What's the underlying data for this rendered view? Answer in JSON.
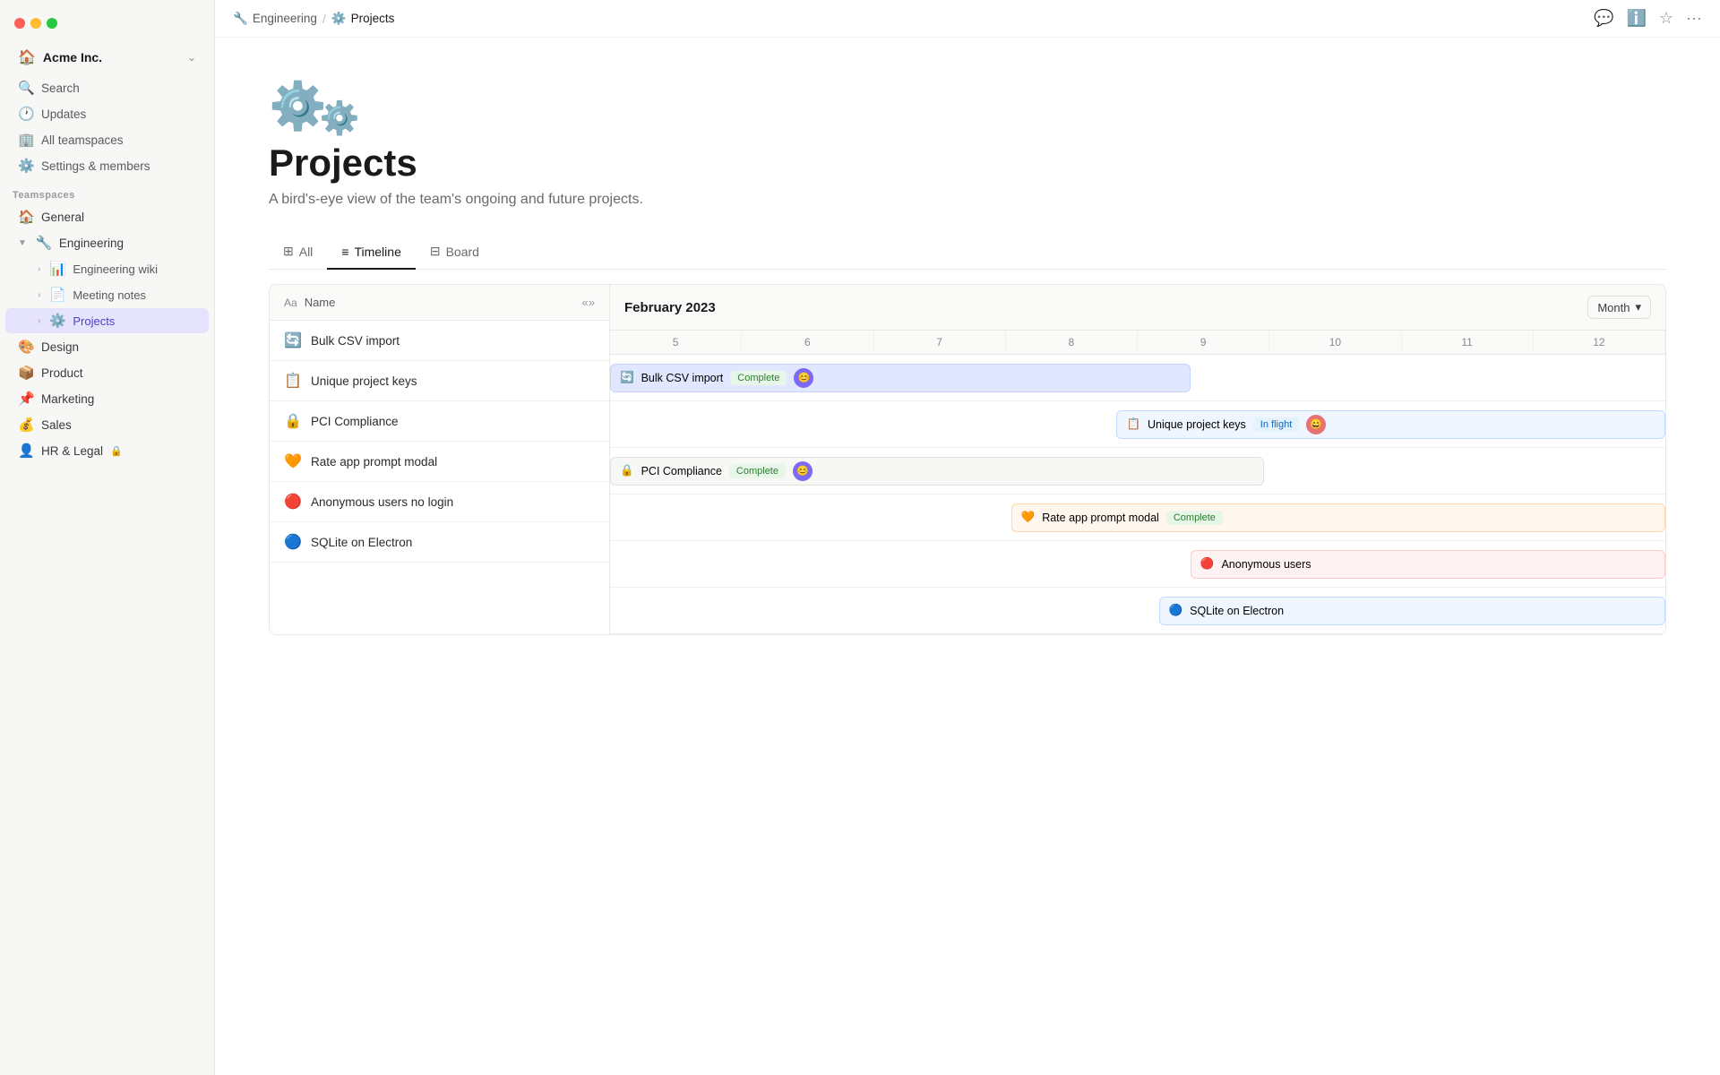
{
  "traffic_lights": [
    "red",
    "yellow",
    "green"
  ],
  "workspace": {
    "name": "Acme Inc.",
    "chevron": "⌃"
  },
  "sidebar_nav": [
    {
      "id": "search",
      "icon": "🔍",
      "label": "Search"
    },
    {
      "id": "updates",
      "icon": "🕐",
      "label": "Updates"
    },
    {
      "id": "all-teamspaces",
      "icon": "🏢",
      "label": "All teamspaces"
    },
    {
      "id": "settings",
      "icon": "⚙️",
      "label": "Settings & members"
    }
  ],
  "teamspaces_label": "Teamspaces",
  "teamspaces": [
    {
      "id": "general",
      "icon": "🏠",
      "label": "General",
      "color": "#e8a020"
    },
    {
      "id": "engineering",
      "icon": "🔧",
      "label": "Engineering",
      "color": "#e05a5a",
      "expanded": true
    },
    {
      "id": "engineering-wiki",
      "icon": "📊",
      "label": "Engineering wiki",
      "indent": true
    },
    {
      "id": "meeting-notes",
      "icon": "📄",
      "label": "Meeting notes",
      "indent": true
    },
    {
      "id": "projects",
      "icon": "⚙️",
      "label": "Projects",
      "indent": true,
      "active": true
    },
    {
      "id": "design",
      "icon": "🎨",
      "label": "Design",
      "color": "#5b9bd5"
    },
    {
      "id": "product",
      "icon": "📦",
      "label": "Product",
      "color": "#e07030"
    },
    {
      "id": "marketing",
      "icon": "📌",
      "label": "Marketing",
      "color": "#c060c0"
    },
    {
      "id": "sales",
      "icon": "💰",
      "label": "Sales",
      "color": "#30a060"
    },
    {
      "id": "hr-legal",
      "icon": "👤",
      "label": "HR & Legal",
      "lock": true
    }
  ],
  "breadcrumb": [
    {
      "id": "engineering",
      "icon": "🔧",
      "label": "Engineering"
    },
    {
      "id": "projects",
      "icon": "⚙️",
      "label": "Projects",
      "current": true
    }
  ],
  "topbar_actions": [
    {
      "id": "comment",
      "icon": "💬"
    },
    {
      "id": "info",
      "icon": "ℹ️"
    },
    {
      "id": "star",
      "icon": "☆"
    },
    {
      "id": "more",
      "icon": "···"
    }
  ],
  "page": {
    "icon": "⚙️",
    "title": "Projects",
    "description": "A bird's-eye view of the team's ongoing and future projects."
  },
  "tabs": [
    {
      "id": "all",
      "icon": "⊞",
      "label": "All"
    },
    {
      "id": "timeline",
      "icon": "≡",
      "label": "Timeline",
      "active": true
    },
    {
      "id": "board",
      "icon": "⊟",
      "label": "Board"
    }
  ],
  "timeline": {
    "collapse_icon": "«»",
    "name_col": "Name",
    "month_label": "February 2023",
    "month_selector": "Month",
    "days": [
      5,
      6,
      7,
      8,
      9,
      10,
      11,
      12
    ],
    "rows": [
      {
        "id": "bulk-csv",
        "icon": "🔄",
        "label": "Bulk CSV import",
        "bar_bg": "#eef2ff",
        "bar_border": "#c7d2fe",
        "bar_label": "Bulk CSV import",
        "status": "Complete",
        "status_class": "status-complete",
        "left_pct": 0,
        "width_pct": 45,
        "has_back_arrow": true,
        "avatar_class": "avatar-1"
      },
      {
        "id": "unique-keys",
        "icon": "📋",
        "label": "Unique project keys",
        "bar_bg": "#eff6ff",
        "bar_border": "#bfdbfe",
        "bar_label": "Unique project keys",
        "status": "In flight",
        "status_class": "status-inflight",
        "left_pct": 50,
        "width_pct": 50,
        "avatar_class": "avatar-2"
      },
      {
        "id": "pci",
        "icon": "🔒",
        "label": "PCI Compliance",
        "bar_bg": "#fafaf9",
        "bar_border": "#e0e0dd",
        "bar_label": "PCI Compliance",
        "status": "Complete",
        "status_class": "status-complete",
        "left_pct": 0,
        "width_pct": 55,
        "avatar_class": "avatar-1"
      },
      {
        "id": "rate-app",
        "icon": "🧡",
        "label": "Rate app prompt modal",
        "bar_bg": "#fff7ed",
        "bar_border": "#fed7aa",
        "bar_label": "Rate app prompt modal",
        "status": "Complete",
        "status_class": "status-complete",
        "left_pct": 40,
        "width_pct": 60
      },
      {
        "id": "anon-users",
        "icon": "🔴",
        "label": "Anonymous users no login",
        "bar_bg": "#fef2f2",
        "bar_border": "#fecaca",
        "bar_label": "Anonymous users",
        "left_pct": 60,
        "width_pct": 40
      },
      {
        "id": "sqlite",
        "icon": "🔵",
        "label": "SQLite on Electron",
        "bar_bg": "#eff6ff",
        "bar_border": "#bfdbfe",
        "bar_label": "SQLite on Electron",
        "left_pct": 55,
        "width_pct": 45
      }
    ]
  }
}
